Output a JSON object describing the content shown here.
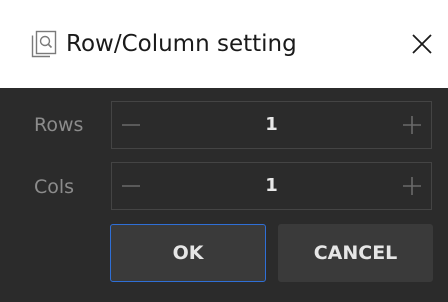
{
  "window": {
    "title": "Row/Column setting",
    "icon": "window-settings-icon",
    "close_icon": "close-icon"
  },
  "fields": [
    {
      "label": "Rows",
      "value": "1",
      "minus_icon": "minus-icon",
      "plus_icon": "plus-icon"
    },
    {
      "label": "Cols",
      "value": "1",
      "minus_icon": "minus-icon",
      "plus_icon": "plus-icon"
    }
  ],
  "buttons": {
    "ok": "OK",
    "cancel": "CANCEL"
  },
  "colors": {
    "body_background": "#2b2b2b",
    "titlebar_background": "#ffffff",
    "button_background": "#3a3a3a",
    "focus_border": "#2f6fd6",
    "label_text": "#8c8c8c",
    "value_text": "#e8e8e8"
  }
}
